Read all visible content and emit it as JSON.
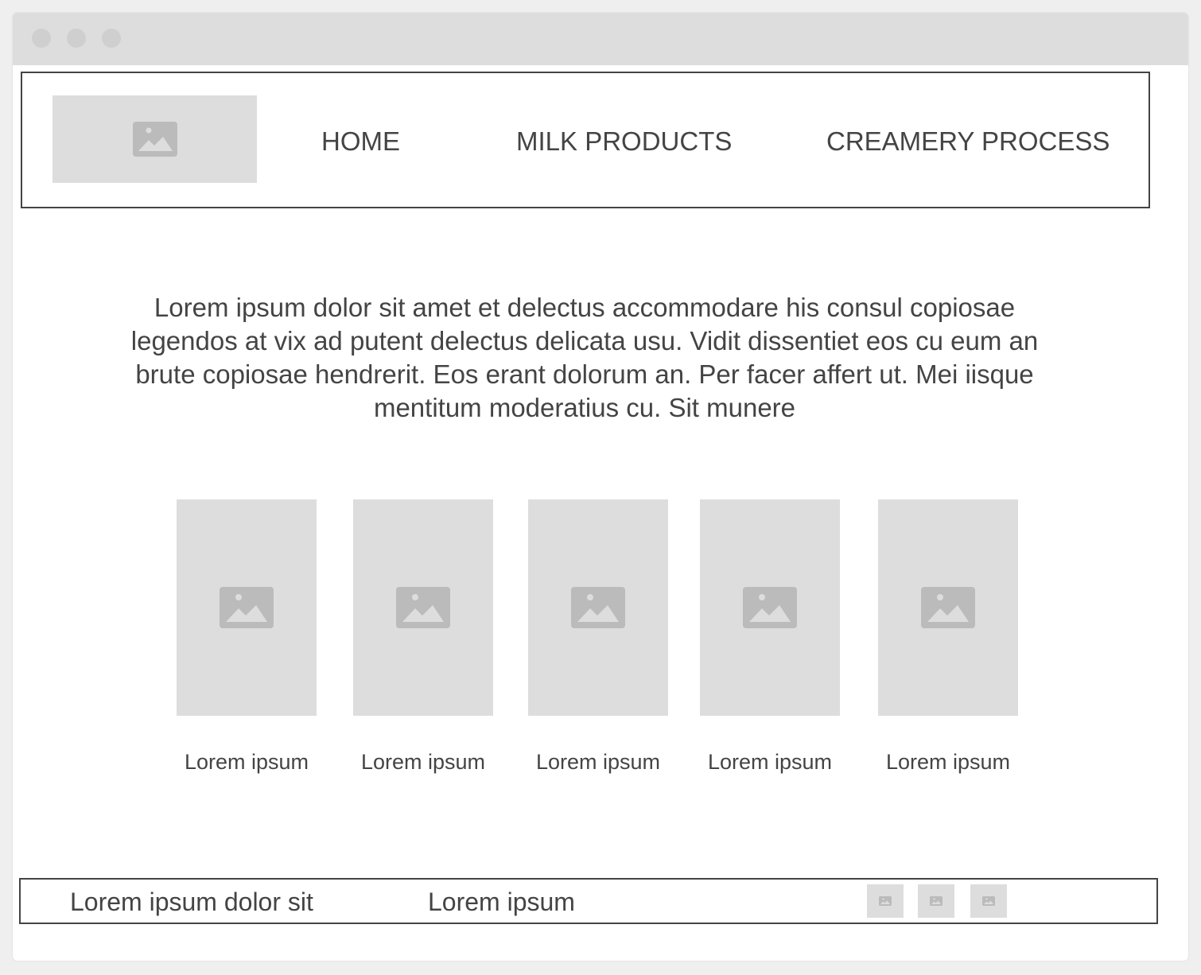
{
  "colors": {
    "page_background": "#efefef",
    "window_background": "#ffffff",
    "titlebar": "#dddddd",
    "placeholder": "#dddddd",
    "placeholder_icon": "#bbbbbb",
    "text": "#444444",
    "border": "#444444"
  },
  "window": {
    "controls": [
      "window-dot",
      "window-dot",
      "window-dot"
    ]
  },
  "header": {
    "logo_icon": "image-placeholder-icon",
    "nav": [
      {
        "label": "HOME"
      },
      {
        "label": "MILK PRODUCTS"
      },
      {
        "label": "CREAMERY PROCESS"
      }
    ]
  },
  "main": {
    "intro": "Lorem ipsum dolor sit amet et delectus accommodare his consul copiosae legendos at vix ad putent delectus delicata usu. Vidit dissentiet eos cu eum an brute copiosae hendrerit. Eos erant dolorum an. Per facer affert ut. Mei iisque mentitum moderatius cu. Sit munere",
    "cards": [
      {
        "caption": "Lorem ipsum",
        "icon": "image-placeholder-icon"
      },
      {
        "caption": "Lorem ipsum",
        "icon": "image-placeholder-icon"
      },
      {
        "caption": "Lorem ipsum",
        "icon": "image-placeholder-icon"
      },
      {
        "caption": "Lorem ipsum",
        "icon": "image-placeholder-icon"
      },
      {
        "caption": "Lorem ipsum",
        "icon": "image-placeholder-icon"
      }
    ]
  },
  "footer": {
    "text_left": "Lorem ipsum dolor sit",
    "text_middle": "Lorem ipsum",
    "social_icons": [
      "image-placeholder-icon",
      "image-placeholder-icon",
      "image-placeholder-icon"
    ]
  }
}
